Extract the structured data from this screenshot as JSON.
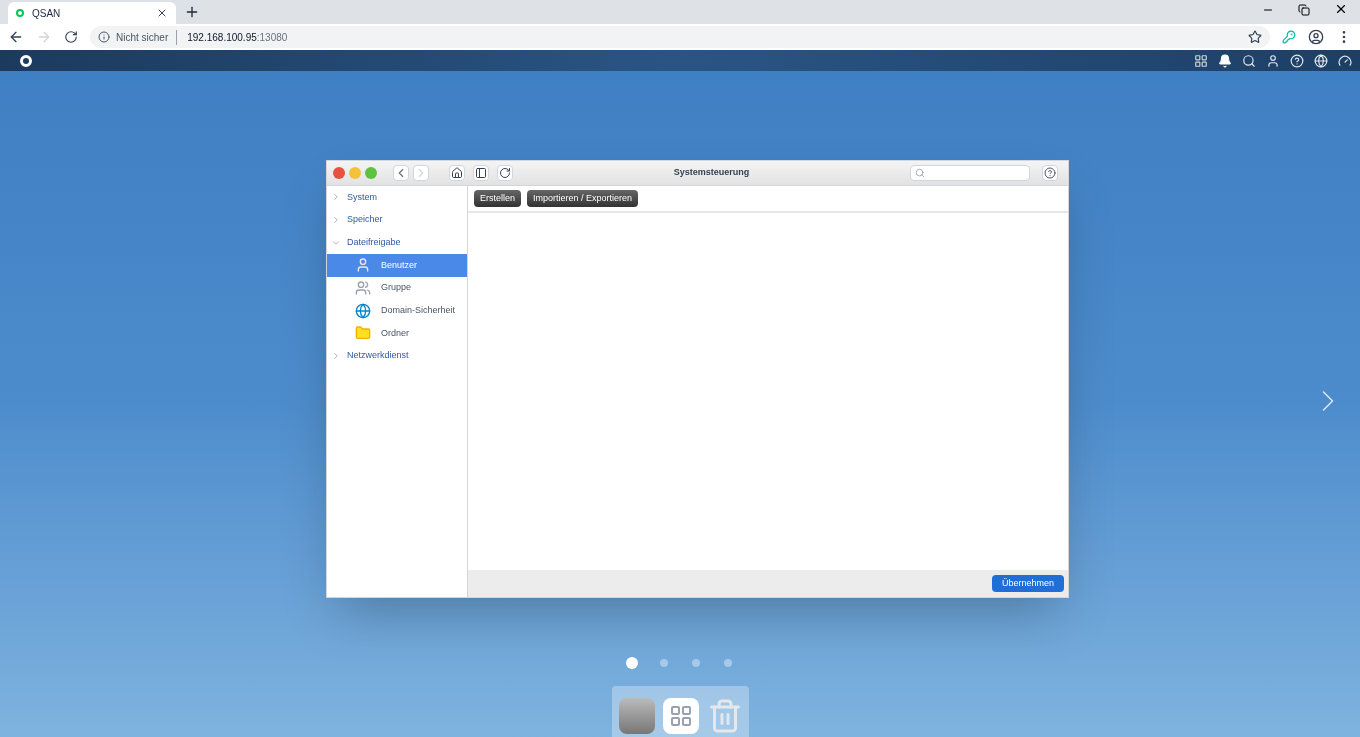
{
  "browser": {
    "tab_title": "QSAN",
    "security": "Nicht sicher",
    "url_host": "192.168.100.95",
    "url_port": ":13080"
  },
  "window": {
    "title": "Systemsteuerung"
  },
  "sidebar": {
    "items": [
      {
        "label": "System",
        "expanded": false
      },
      {
        "label": "Speicher",
        "expanded": false
      },
      {
        "label": "Dateifreigabe",
        "expanded": true,
        "children": [
          {
            "label": "Benutzer",
            "kind": "user",
            "selected": true
          },
          {
            "label": "Gruppe",
            "kind": "group",
            "selected": false
          },
          {
            "label": "Domain-Sicherheit",
            "kind": "domain",
            "selected": false
          },
          {
            "label": "Ordner",
            "kind": "folder",
            "selected": false
          }
        ]
      },
      {
        "label": "Netzwerkdienst",
        "expanded": false
      }
    ]
  },
  "toolbar": {
    "buttons": [
      "Erstellen",
      "Importieren / Exportieren"
    ]
  },
  "footer": {
    "apply_button": "Übernehmen"
  },
  "page_dots": [
    {
      "selected": true
    },
    {
      "selected": false
    },
    {
      "selected": false
    },
    {
      "selected": false
    }
  ]
}
